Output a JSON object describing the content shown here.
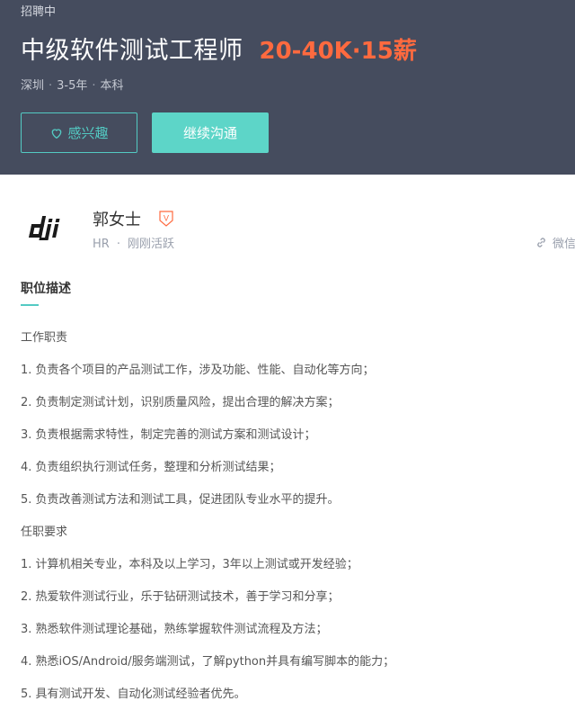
{
  "header": {
    "status": "招聘中",
    "title": "中级软件测试工程师",
    "salary": "20-40K·15薪",
    "meta": [
      "深圳",
      "3-5年",
      "本科"
    ],
    "interest_label": "感兴趣",
    "chat_label": "继续沟通"
  },
  "recruiter": {
    "company_logo": "dji",
    "name": "郭女士",
    "badge": "V",
    "role": "HR",
    "activity": "刚刚活跃",
    "wechat_label": "微信"
  },
  "description": {
    "section_title": "职位描述",
    "lines": [
      "工作职责",
      "1. 负责各个项目的产品测试工作，涉及功能、性能、自动化等方向；",
      "2. 负责制定测试计划，识别质量风险，提出合理的解决方案；",
      "3. 负责根据需求特性，制定完善的测试方案和测试设计；",
      "4. 负责组织执行测试任务，整理和分析测试结果；",
      "5. 负责改善测试方法和测试工具，促进团队专业水平的提升。",
      "任职要求",
      "1. 计算机相关专业，本科及以上学习，3年以上测试或开发经验；",
      "2. 热爱软件测试行业，乐于钻研测试技术，善于学习和分享；",
      "3. 熟悉软件测试理论基础，熟练掌握软件测试流程及方法；",
      "4. 熟悉iOS/Android/服务端测试，了解python并具有编写脚本的能力；",
      "5. 具有测试开发、自动化测试经验者优先。"
    ]
  },
  "colors": {
    "header_bg": "#454c5e",
    "salary": "#ff6a3f",
    "accent": "#53cac3",
    "chat_button": "#5dd5c8",
    "badge": "#ff6a3f"
  }
}
